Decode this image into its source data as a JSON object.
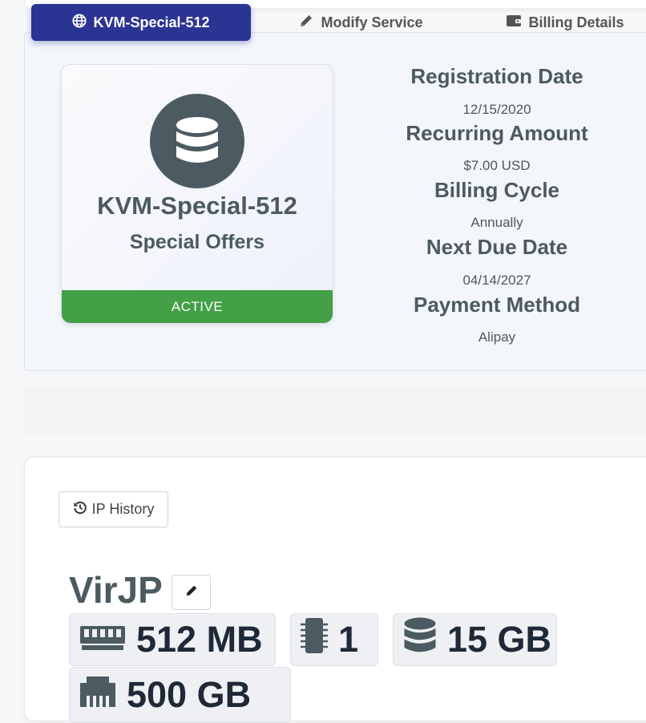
{
  "product": {
    "name": "KVM-Special-512",
    "group": "Special Offers",
    "status": "ACTIVE",
    "icon": "database-icon"
  },
  "info": [
    {
      "label": "Registration Date",
      "value": "12/15/2020"
    },
    {
      "label": "Recurring Amount",
      "value": "$7.00 USD"
    },
    {
      "label": "Billing Cycle",
      "value": "Annually"
    },
    {
      "label": "Next Due Date",
      "value": "04/14/2027"
    },
    {
      "label": "Payment Method",
      "value": "Alipay"
    }
  ],
  "tabs": [
    {
      "label": "KVM-Special-512",
      "icon": "globe-icon",
      "active": true
    },
    {
      "label": "Modify Service",
      "icon": "pencil-icon",
      "active": false
    },
    {
      "label": "Billing Details",
      "icon": "wallet-icon",
      "active": false
    }
  ],
  "actions": {
    "ip_history_label": "IP History"
  },
  "server": {
    "hostname": "VirJP",
    "specs": {
      "memory": "512 MB",
      "cpu": "1",
      "disk": "15 GB",
      "bandwidth": "500 GB"
    }
  },
  "colors": {
    "accent": "#2a3493",
    "status_active": "#43a047",
    "heading": "#4c5a61"
  }
}
